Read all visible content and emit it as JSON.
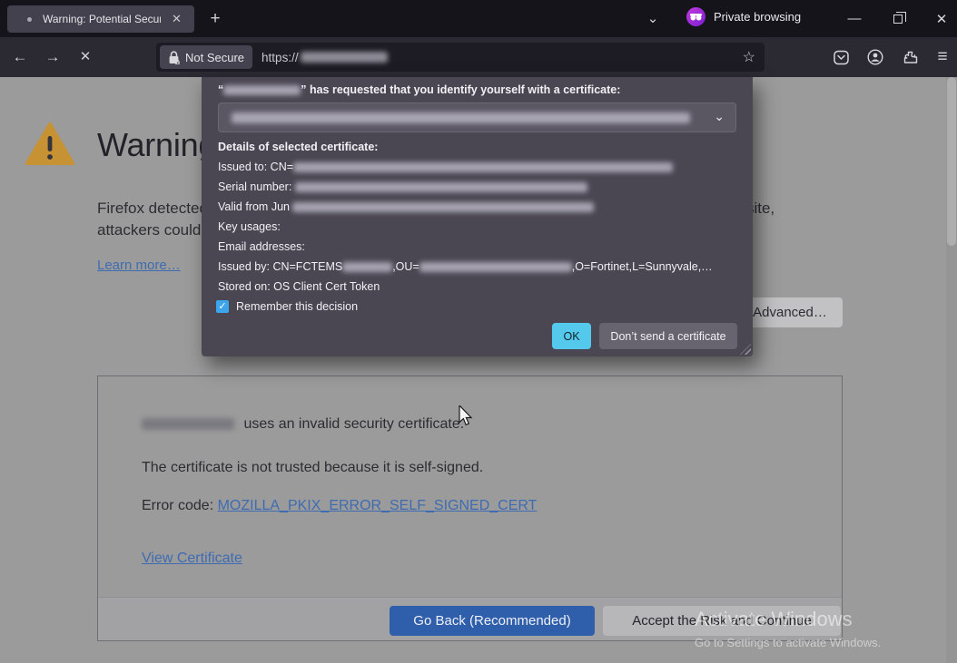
{
  "icons": {
    "plus": "+",
    "chevron_down": "⌄",
    "minimize": "—",
    "close": "✕",
    "back": "←",
    "forward": "→",
    "stop": "✕",
    "star": "☆",
    "hamburger": "≡",
    "check": "✓"
  },
  "titlebar": {
    "tab_title": "Warning: Potential Security Risk",
    "private_label": "Private browsing"
  },
  "navbar": {
    "security_label": "Not Secure",
    "url_scheme": "https://"
  },
  "dialog": {
    "request_prefix": "“",
    "request_text": "” has requested that you identify yourself with a certificate:",
    "details_title": "Details of selected certificate:",
    "issued_to_label": "Issued to: CN=",
    "serial_label": "Serial number:",
    "valid_from_label": "Valid from Jun",
    "key_usages_label": "Key usages:",
    "email_label": "Email addresses:",
    "issued_by_pre": "Issued by: CN=FCTEMS",
    "issued_by_mid": ",OU=",
    "issued_by_post": ",O=Fortinet,L=Sunnyvale,…",
    "stored_on": "Stored on: OS Client Cert Token",
    "remember_label": "Remember this decision",
    "ok_button": "OK",
    "dont_send_button": "Don’t send a certificate"
  },
  "page": {
    "heading": "Warning: Potential Security Risk Ahead",
    "body_line1_pre": "Firefox detected a potential security threat and did not continue to ",
    "body_line1_post": ". If you visit this site,",
    "body_line2": "attackers could try to steal information like your passwords, emails, or credit card details.",
    "learn_more": "Learn more…",
    "advanced_button": "Advanced…",
    "box": {
      "line1_suffix": " uses an invalid security certificate.",
      "line2": "The certificate is not trusted because it is self-signed.",
      "error_code_label": "Error code: ",
      "error_code_link": "MOZILLA_PKIX_ERROR_SELF_SIGNED_CERT",
      "view_certificate_link": "View Certificate",
      "go_back_button": "Go Back (Recommended)",
      "accept_button": "Accept the Risk and Continue"
    },
    "watermark": {
      "line1": "Activate Windows",
      "line2": "Go to Settings to activate Windows."
    }
  },
  "colors": {
    "accent_ok": "#55c9ec",
    "primary_button": "#2f5fab",
    "private_purple": "#a12de0",
    "warning_amber": "#c79233",
    "link_blue": "#3f6cb1"
  }
}
